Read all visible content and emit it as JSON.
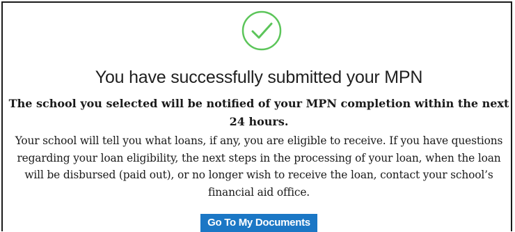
{
  "confirmation": {
    "icon": "checkmark-circle-icon",
    "icon_color": "#5cc55a",
    "title": "You have successfully submitted your MPN",
    "notice_line1": "The school you selected will be notified of your MPN completion within the next",
    "notice_line2": "24 hours.",
    "body_line1": "Your school will tell you what loans, if any, you are eligible to receive. If you have questions",
    "body_line2": "regarding your loan eligibility, the next steps in the processing of your loan, when the loan",
    "body_line3": "will be disbursed (paid out), or no longer wish to receive the loan, contact your school’s",
    "body_line4": "financial aid office.",
    "button_label": "Go To My Documents",
    "button_color": "#1b77c5"
  }
}
